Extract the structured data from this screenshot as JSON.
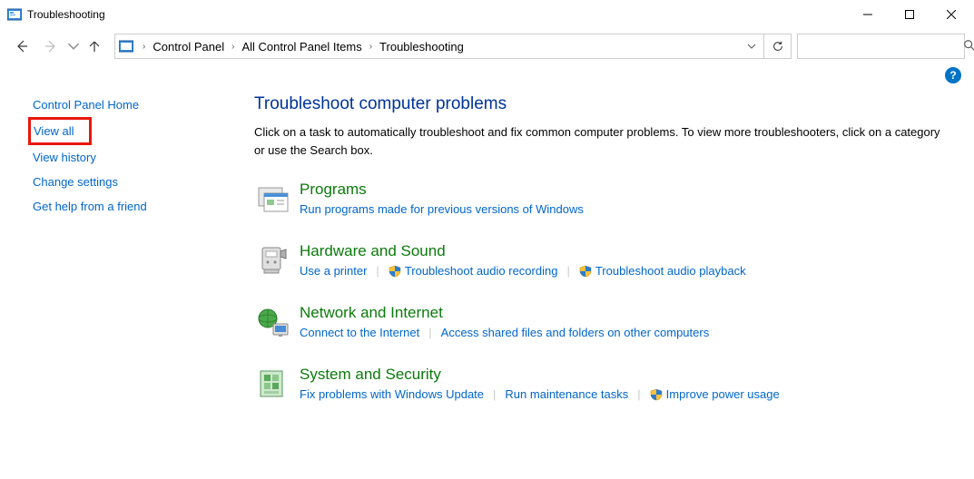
{
  "window": {
    "title": "Troubleshooting"
  },
  "breadcrumb": {
    "items": [
      "Control Panel",
      "All Control Panel Items",
      "Troubleshooting"
    ]
  },
  "search": {
    "placeholder": ""
  },
  "sidebar": {
    "home": "Control Panel Home",
    "view_all": "View all",
    "view_history": "View history",
    "change_settings": "Change settings",
    "get_help": "Get help from a friend"
  },
  "main": {
    "title": "Troubleshoot computer problems",
    "subtitle": "Click on a task to automatically troubleshoot and fix common computer problems. To view more troubleshooters, click on a category or use the Search box.",
    "categories": {
      "programs": {
        "title": "Programs",
        "links": [
          "Run programs made for previous versions of Windows"
        ]
      },
      "hardware": {
        "title": "Hardware and Sound",
        "links": [
          "Use a printer",
          "Troubleshoot audio recording",
          "Troubleshoot audio playback"
        ]
      },
      "network": {
        "title": "Network and Internet",
        "links": [
          "Connect to the Internet",
          "Access shared files and folders on other computers"
        ]
      },
      "system": {
        "title": "System and Security",
        "links": [
          "Fix problems with Windows Update",
          "Run maintenance tasks",
          "Improve power usage"
        ]
      }
    }
  }
}
